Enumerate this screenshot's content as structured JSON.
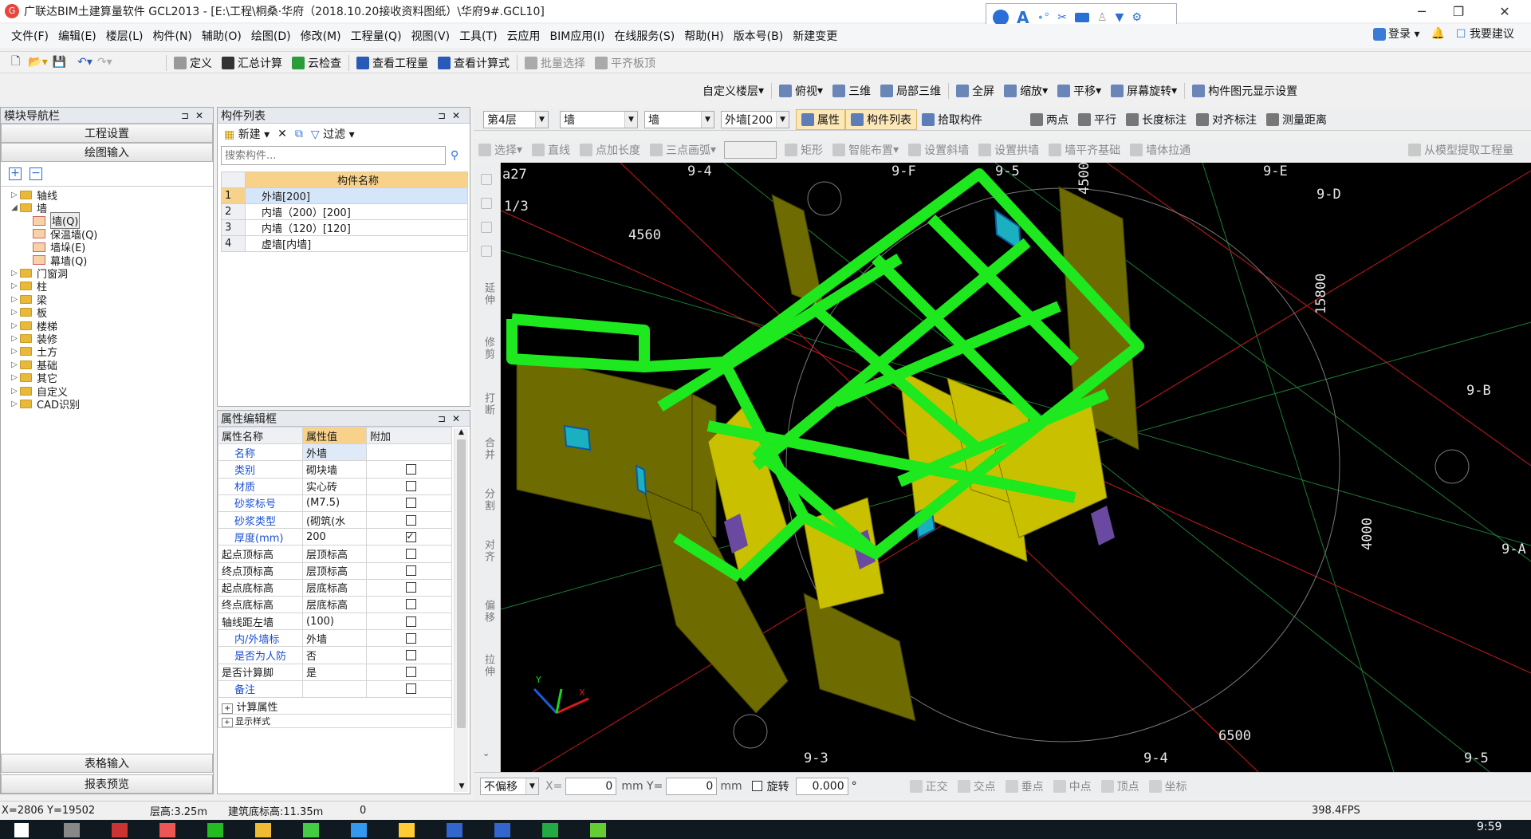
{
  "app": {
    "title": "广联达BIM土建算量软件 GCL2013 - [E:\\工程\\桐桑·华府（2018.10.20接收资料图纸）\\华府9#.GCL10]"
  },
  "menu": [
    "文件(F)",
    "编辑(E)",
    "楼层(L)",
    "构件(N)",
    "辅助(O)",
    "绘图(D)",
    "修改(M)",
    "工程量(Q)",
    "视图(V)",
    "工具(T)",
    "云应用",
    "BIM应用(I)",
    "在线服务(S)",
    "帮助(H)",
    "版本号(B)",
    "新建变更"
  ],
  "topright": {
    "login": "登录",
    "suggest": "我要建议"
  },
  "toolbar1": [
    "定义",
    "汇总计算",
    "云检查",
    "查看工程量",
    "查看计算式",
    "批量选择",
    "平齐板顶"
  ],
  "toolbar2": [
    "自定义楼层",
    "俯视",
    "三维",
    "局部三维",
    "全屏",
    "缩放",
    "平移",
    "屏幕旋转",
    "构件图元显示设置"
  ],
  "toolbar3": {
    "floor": "第4层",
    "cat1": "墙",
    "cat2": "墙",
    "comp": "外墙[200",
    "btns": [
      "属性",
      "构件列表",
      "拾取构件"
    ],
    "right": [
      "两点",
      "平行",
      "长度标注",
      "对齐标注",
      "测量距离"
    ]
  },
  "toolbar4": [
    "选择",
    "直线",
    "点加长度",
    "三点画弧",
    "矩形",
    "智能布置",
    "设置斜墙",
    "设置拱墙",
    "墙平齐基础",
    "墙体拉通",
    "从模型提取工程量"
  ],
  "nav": {
    "title": "模块导航栏",
    "btn_setup": "工程设置",
    "btn_draw": "绘图输入",
    "tree": [
      {
        "label": "轴线",
        "level": 0,
        "icon": "folder",
        "arrow": "▷"
      },
      {
        "label": "墙",
        "level": 0,
        "icon": "folder",
        "arrow": "◢"
      },
      {
        "label": "墙(Q)",
        "level": 1,
        "icon": "wall",
        "sel": true
      },
      {
        "label": "保温墙(Q)",
        "level": 1,
        "icon": "wall"
      },
      {
        "label": "墙垛(E)",
        "level": 1,
        "icon": "wall"
      },
      {
        "label": "幕墙(Q)",
        "level": 1,
        "icon": "wall"
      },
      {
        "label": "门窗洞",
        "level": 0,
        "icon": "folder",
        "arrow": "▷"
      },
      {
        "label": "柱",
        "level": 0,
        "icon": "folder",
        "arrow": "▷"
      },
      {
        "label": "梁",
        "level": 0,
        "icon": "folder",
        "arrow": "▷"
      },
      {
        "label": "板",
        "level": 0,
        "icon": "folder",
        "arrow": "▷"
      },
      {
        "label": "楼梯",
        "level": 0,
        "icon": "folder",
        "arrow": "▷"
      },
      {
        "label": "装修",
        "level": 0,
        "icon": "folder",
        "arrow": "▷"
      },
      {
        "label": "土方",
        "level": 0,
        "icon": "folder",
        "arrow": "▷"
      },
      {
        "label": "基础",
        "level": 0,
        "icon": "folder",
        "arrow": "▷"
      },
      {
        "label": "其它",
        "level": 0,
        "icon": "folder",
        "arrow": "▷"
      },
      {
        "label": "自定义",
        "level": 0,
        "icon": "folder",
        "arrow": "▷"
      },
      {
        "label": "CAD识别",
        "level": 0,
        "icon": "folder",
        "arrow": "▷"
      }
    ],
    "btn_table": "表格输入",
    "btn_report": "报表预览"
  },
  "complist": {
    "title": "构件列表",
    "new": "新建",
    "filter": "过滤",
    "search_placeholder": "搜索构件...",
    "header": "构件名称",
    "rows": [
      {
        "n": "1",
        "name": "外墙[200]"
      },
      {
        "n": "2",
        "name": "内墙（200）[200]"
      },
      {
        "n": "3",
        "name": "内墙（120）[120]"
      },
      {
        "n": "4",
        "name": "虚墙[内墙]"
      }
    ]
  },
  "props": {
    "title": "属性编辑框",
    "h1": "属性名称",
    "h2": "属性值",
    "h3": "附加",
    "rows": [
      {
        "name": "名称",
        "val": "外墙",
        "blue": true,
        "cb": null
      },
      {
        "name": "类别",
        "val": "砌块墙",
        "blue": true,
        "cb": false
      },
      {
        "name": "材质",
        "val": "实心砖",
        "blue": true,
        "cb": false
      },
      {
        "name": "砂浆标号",
        "val": "(M7.5)",
        "blue": true,
        "cb": false
      },
      {
        "name": "砂浆类型",
        "val": "(砌筑(水",
        "blue": true,
        "cb": false
      },
      {
        "name": "厚度(mm)",
        "val": "200",
        "blue": true,
        "cb": true
      },
      {
        "name": "起点顶标高",
        "val": "层顶标高",
        "blue": false,
        "cb": false
      },
      {
        "name": "终点顶标高",
        "val": "层顶标高",
        "blue": false,
        "cb": false
      },
      {
        "name": "起点底标高",
        "val": "层底标高",
        "blue": false,
        "cb": false
      },
      {
        "name": "终点底标高",
        "val": "层底标高",
        "blue": false,
        "cb": false
      },
      {
        "name": "轴线距左墙",
        "val": "(100)",
        "blue": false,
        "cb": false
      },
      {
        "name": "内/外墙标",
        "val": "外墙",
        "blue": true,
        "cb": false
      },
      {
        "name": "是否为人防",
        "val": "否",
        "blue": true,
        "cb": false
      },
      {
        "name": "是否计算脚",
        "val": "是",
        "blue": false,
        "cb": false
      },
      {
        "name": "备注",
        "val": "",
        "blue": true,
        "cb": false
      }
    ],
    "group1": "计算属性",
    "group2": "显示样式"
  },
  "sidetools": [
    "延伸",
    "修剪",
    "打断",
    "合并",
    "分割",
    "对齐",
    "偏移",
    "拉伸"
  ],
  "axes": [
    "a27",
    "1/3",
    "9-4",
    "9-F",
    "9-5",
    "9-E",
    "9-D",
    "9-B",
    "9-A",
    "9-3",
    "9-4",
    "9-5"
  ],
  "dims": [
    "4560",
    "4500",
    "15800",
    "4000",
    "6500"
  ],
  "bottombar": {
    "offset": "不偏移",
    "x_label": "X=",
    "x": "0",
    "y_label": "mm Y=",
    "y": "0",
    "unit": "mm",
    "rotate": "旋转",
    "angle": "0.000",
    "snaps": [
      "正交",
      "交点",
      "垂点",
      "中点",
      "顶点",
      "坐标"
    ]
  },
  "status": {
    "coords": "X=2806 Y=19502",
    "floor_h": "层高:3.25m",
    "base": "建筑底标高:11.35m",
    "zero": "0",
    "fps": "398.4FPS"
  },
  "clock": "9:59"
}
